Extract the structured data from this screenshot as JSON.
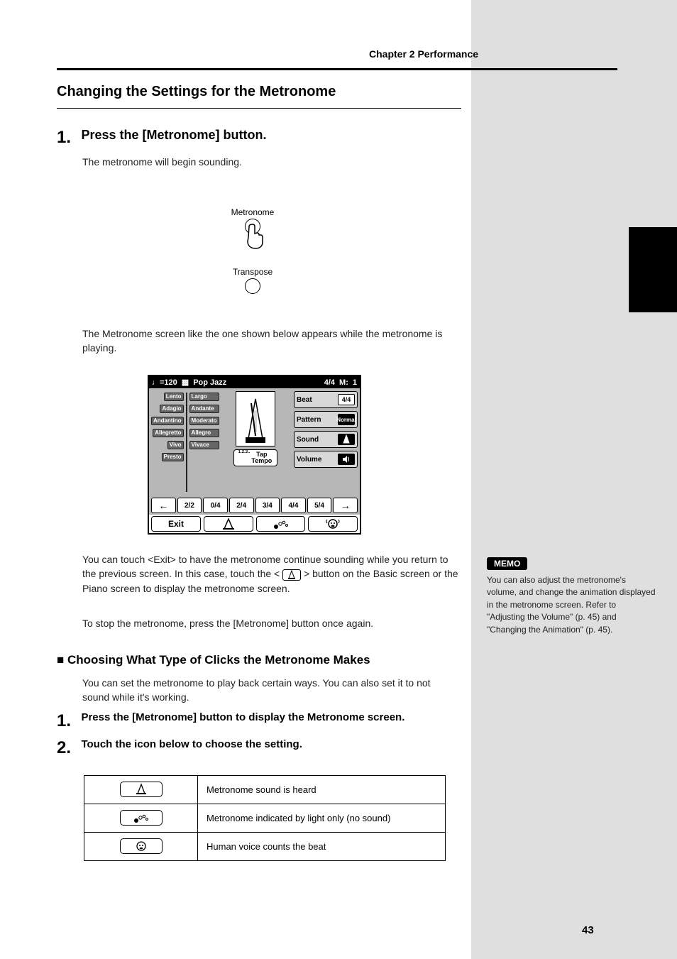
{
  "page": {
    "chapter_title": "Chapter 2 Performance",
    "number": "43"
  },
  "heading_main": "Changing the Settings for the Metronome",
  "step1_a": "1.",
  "step1_b": "Press the [Metronome] button.",
  "step1_desc": "The metronome will begin sounding.",
  "figure": {
    "label_top": "Metronome",
    "label_bottom": "Transpose"
  },
  "step2": "The Metronome screen like the one shown below appears while the metronome is playing.",
  "device": {
    "top_tempo": "♩=120",
    "top_style_icon": "▦",
    "top_style": "Pop Jazz",
    "top_sig": "4/4",
    "top_meas_label": "M:",
    "top_meas": "1",
    "tempo_left": [
      "Lento",
      "Adagio",
      "Andantino",
      "Allegretto",
      "Vivo",
      "Presto"
    ],
    "tempo_right": [
      "Largo",
      "Andante",
      "Moderato",
      "Allegro",
      "Vivace"
    ],
    "tap_small": "1.2.3..",
    "tap_label": "Tap\nTempo",
    "btn_beat": "Beat",
    "btn_beat_val": "4/4",
    "btn_pattern": "Pattern",
    "btn_pattern_val": "Normal",
    "btn_sound": "Sound",
    "btn_volume": "Volume",
    "timesigs": [
      "←",
      "2/2",
      "0/4",
      "2/4",
      "3/4",
      "4/4",
      "5/4",
      "→"
    ],
    "bottom": [
      "Exit",
      "metronome-icon",
      "dots-icon",
      "face-icon"
    ]
  },
  "para3": "You can touch <Exit> to have the metronome continue sounding while you return to the previous screen. In this case, touch the <",
  "para3_tail": "> button on the Basic screen or the Piano screen to display the metronome screen.",
  "para4": "To stop the metronome, press the [Metronome] button once again.",
  "section2": "■ Choosing What Type of Clicks the Metronome Makes",
  "para5": "You can set the metronome to play back certain ways. You can also set it to not sound while it's working.",
  "step_a1": "1.",
  "step_a1_b": "Press the [Metronome] button to display the Metronome screen.",
  "step_a2": "2.",
  "step_a2_b": "Touch the icon below to choose the setting.",
  "table": {
    "r1": "Metronome sound is heard",
    "r2": "Metronome indicated by light only (no sound)",
    "r3": "Human voice counts the beat"
  },
  "side_note_title": "MEMO",
  "side_note": "You can also adjust the metronome's volume, and change the animation displayed in the metronome screen. Refer to \"Adjusting the Volume\" (p. 45) and \"Changing the Animation\" (p. 45)."
}
